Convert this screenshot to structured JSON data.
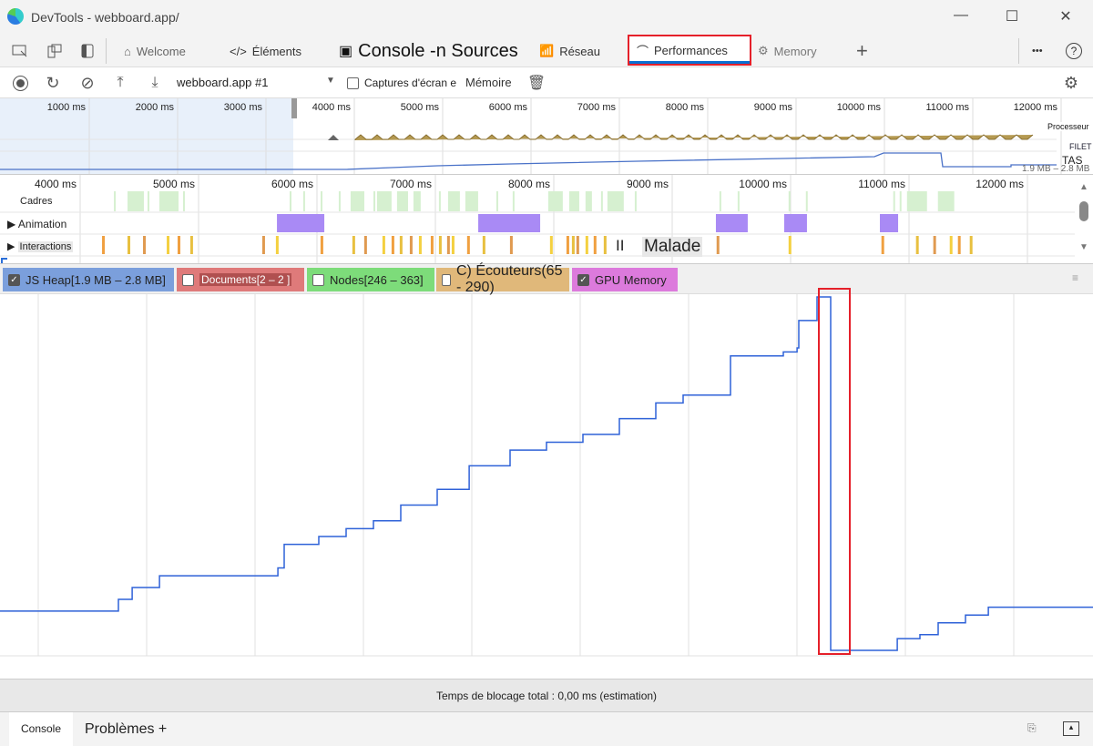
{
  "window": {
    "title": "DevTools - webboard.app/",
    "minimize": "—",
    "maximize": "☐",
    "close": "✕"
  },
  "tabs": [
    {
      "label": "Welcome",
      "icon": "home-icon"
    },
    {
      "label": "Éléments",
      "icon": "code-icon"
    },
    {
      "label": "Console -n Sources",
      "icon": "console-icon"
    },
    {
      "label": "Réseau",
      "icon": "wifi-icon"
    },
    {
      "label": "Performances",
      "icon": "gauge-icon",
      "active": true
    },
    {
      "label": "Memory",
      "icon": "chip-icon"
    }
  ],
  "tabbar": {
    "add": "+",
    "more": "•••",
    "help": "?"
  },
  "toolbar": {
    "profile": "webboard.app #1",
    "screenshots_label": "Captures d'écran e",
    "memory_label": "Mémoire"
  },
  "overview": {
    "ticks": [
      "1000 ms",
      "2000 ms",
      "3000 ms",
      "4000 ms",
      "5000 ms",
      "6000 ms",
      "7000 ms",
      "8000 ms",
      "9000 ms",
      "10000 ms",
      "11000 ms",
      "12000 ms"
    ],
    "cpu_label": "Processeur",
    "net_label": "FILET",
    "heap_label": "TAS",
    "heap_range": "1.9 MB – 2.8 MB"
  },
  "tracks": {
    "ticks": [
      "4000 ms",
      "5000 ms",
      "6000 ms",
      "7000 ms",
      "8000 ms",
      "9000 ms",
      "10000 ms",
      "11000 ms",
      "12000 ms"
    ],
    "frames_label": "Cadres",
    "animation_label": "Animation",
    "interactions_label": "Interactions",
    "overlay_pause": "II",
    "overlay_text": "Malade",
    "frames_ms": [
      [
        4285,
        4300
      ],
      [
        4400,
        4538
      ],
      [
        4569,
        4584
      ],
      [
        4669,
        4831
      ],
      [
        4869,
        4884
      ],
      [
        5769,
        5784
      ],
      [
        5884,
        5899
      ],
      [
        6031,
        6046
      ],
      [
        6184,
        6199
      ],
      [
        6284,
        6400
      ],
      [
        6477,
        6492
      ],
      [
        6507,
        6630
      ],
      [
        6676,
        6769
      ],
      [
        6815,
        6876
      ],
      [
        7030,
        7045
      ],
      [
        7107,
        7207
      ],
      [
        7253,
        7361
      ],
      [
        7515,
        7530
      ],
      [
        7653,
        7668
      ],
      [
        7953,
        8076
      ],
      [
        8130,
        8215
      ],
      [
        8268,
        8322
      ],
      [
        8399,
        8414
      ],
      [
        8453,
        8591
      ],
      [
        8684,
        8699
      ],
      [
        9399,
        9414
      ],
      [
        9553,
        9568
      ],
      [
        9983,
        9998
      ],
      [
        10129,
        10144
      ],
      [
        10867,
        10882
      ],
      [
        10921,
        10936
      ],
      [
        10983,
        11152
      ],
      [
        11244,
        11382
      ]
    ],
    "animations_ms": [
      [
        5662,
        6062
      ],
      [
        7362,
        7885
      ],
      [
        9369,
        9638
      ],
      [
        9946,
        10138
      ],
      [
        10754,
        10908
      ]
    ],
    "interactions_ms": [
      4185,
      4400,
      4531,
      4731,
      4823,
      4930,
      5538,
      5653,
      6030,
      6299,
      6399,
      6553,
      6630,
      6699,
      6784,
      6861,
      6961,
      7030,
      7099,
      7138,
      7268,
      7399,
      7630,
      7968,
      8107,
      8153,
      8191,
      8268,
      8337,
      8422,
      9375,
      9983,
      10767,
      11059,
      11205,
      11344,
      11413,
      11513
    ]
  },
  "counters": [
    {
      "label": "JS Heap[1.9 MB – 2.8 MB]",
      "checked": true,
      "color": "#7b9fdc"
    },
    {
      "label": "Documents[2 – 2  ]",
      "checked": false,
      "color": "#df7a7a"
    },
    {
      "label": "Nodes[246 – 363]",
      "checked": false,
      "color": "#7ddc7a"
    },
    {
      "label": "C) Écouteurs(65 - 290)",
      "checked": false,
      "color": "#e0b87a"
    },
    {
      "label": "GPU Memory",
      "checked": true,
      "color": "#dc7adc"
    }
  ],
  "colors": {
    "heap_line": "#2f62d8",
    "highlight": "#e5202a",
    "accent": "#0a6ed1",
    "animation": "#a98af5",
    "frame": "#d6f0d0"
  },
  "chart_data": {
    "type": "line",
    "series": [
      {
        "name": "JS Heap",
        "unit": "MB",
        "points": [
          [
            3700,
            2.0
          ],
          [
            4609,
            2.0
          ],
          [
            4727,
            2.03
          ],
          [
            4846,
            2.06
          ],
          [
            5083,
            2.09
          ],
          [
            5320,
            2.09
          ],
          [
            6110,
            2.11
          ],
          [
            6165,
            2.17
          ],
          [
            6465,
            2.19
          ],
          [
            6702,
            2.21
          ],
          [
            6939,
            2.23
          ],
          [
            7176,
            2.27
          ],
          [
            7492,
            2.31
          ],
          [
            7769,
            2.37
          ],
          [
            8124,
            2.41
          ],
          [
            8440,
            2.43
          ],
          [
            8756,
            2.45
          ],
          [
            9072,
            2.49
          ],
          [
            9388,
            2.53
          ],
          [
            9625,
            2.55
          ],
          [
            10036,
            2.65
          ],
          [
            10494,
            2.66
          ],
          [
            10613,
            2.67
          ],
          [
            10628,
            2.74
          ],
          [
            10786,
            2.8
          ],
          [
            10905,
            1.9
          ],
          [
            11403,
            1.9
          ],
          [
            11482,
            1.93
          ],
          [
            11679,
            1.94
          ],
          [
            11837,
            1.97
          ],
          [
            12074,
            1.99
          ],
          [
            12272,
            2.01
          ],
          [
            13180,
            2.01
          ]
        ]
      }
    ],
    "ylim": [
      1.9,
      2.8
    ],
    "grid": true
  },
  "status": {
    "text": "Temps de blocage total : 0,00 ms (estimation)"
  },
  "drawer": {
    "tabs": [
      "Console",
      "Problèmes +"
    ]
  }
}
